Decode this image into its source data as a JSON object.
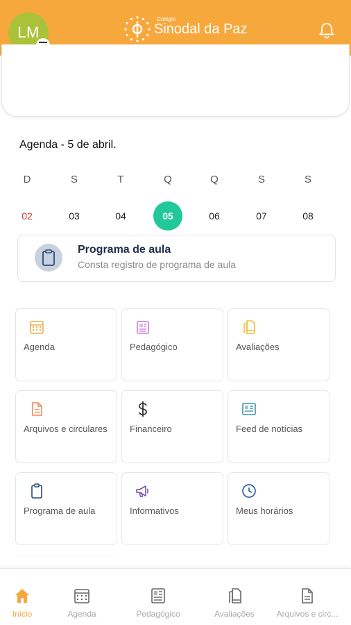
{
  "header": {
    "avatar_initials": "LM",
    "logo_small": "Colégio",
    "logo_name": "Sinodal da Paz",
    "brand_color": "#f7a83c",
    "avatar_color": "#a9c23a"
  },
  "agenda": {
    "title": "Agenda - 5 de abril.",
    "days": [
      {
        "letter": "D",
        "num": "02",
        "state": "sunday"
      },
      {
        "letter": "S",
        "num": "03",
        "state": "normal"
      },
      {
        "letter": "T",
        "num": "04",
        "state": "normal"
      },
      {
        "letter": "Q",
        "num": "05",
        "state": "selected"
      },
      {
        "letter": "Q",
        "num": "06",
        "state": "normal"
      },
      {
        "letter": "S",
        "num": "07",
        "state": "normal"
      },
      {
        "letter": "S",
        "num": "08",
        "state": "normal"
      }
    ],
    "selected_color": "#20c997"
  },
  "program_card": {
    "title": "Programa de aula",
    "subtitle": "Consta registro de programa de aula",
    "icon": "clipboard-icon"
  },
  "menu": [
    {
      "label": "Agenda",
      "icon": "calendar-icon",
      "color": "#f0b04a"
    },
    {
      "label": "Pedagógico",
      "icon": "book-icon",
      "color": "#c77dd9"
    },
    {
      "label": "Avaliações",
      "icon": "documents-icon",
      "color": "#e6c23a"
    },
    {
      "label": "Arquivos e circulares",
      "icon": "file-icon",
      "color": "#f08a5b"
    },
    {
      "label": "Financeiro",
      "icon": "dollar-icon",
      "color": "#333333"
    },
    {
      "label": "Feed de notícias",
      "icon": "newspaper-icon",
      "color": "#3b93a8"
    },
    {
      "label": "Programa de aula",
      "icon": "clipboard-icon",
      "color": "#2d4a7a"
    },
    {
      "label": "Informativos",
      "icon": "megaphone-icon",
      "color": "#7a4fb5"
    },
    {
      "label": "Meus horários",
      "icon": "clock-icon",
      "color": "#3560a8"
    }
  ],
  "bottom_nav": [
    {
      "label": "Início",
      "icon": "home-icon",
      "active": true
    },
    {
      "label": "Agenda",
      "icon": "calendar-icon",
      "active": false
    },
    {
      "label": "Pedagógico",
      "icon": "book-icon",
      "active": false
    },
    {
      "label": "Avaliações",
      "icon": "documents-icon",
      "active": false
    },
    {
      "label": "Arquivos e circ...",
      "icon": "file-icon",
      "active": false
    }
  ]
}
